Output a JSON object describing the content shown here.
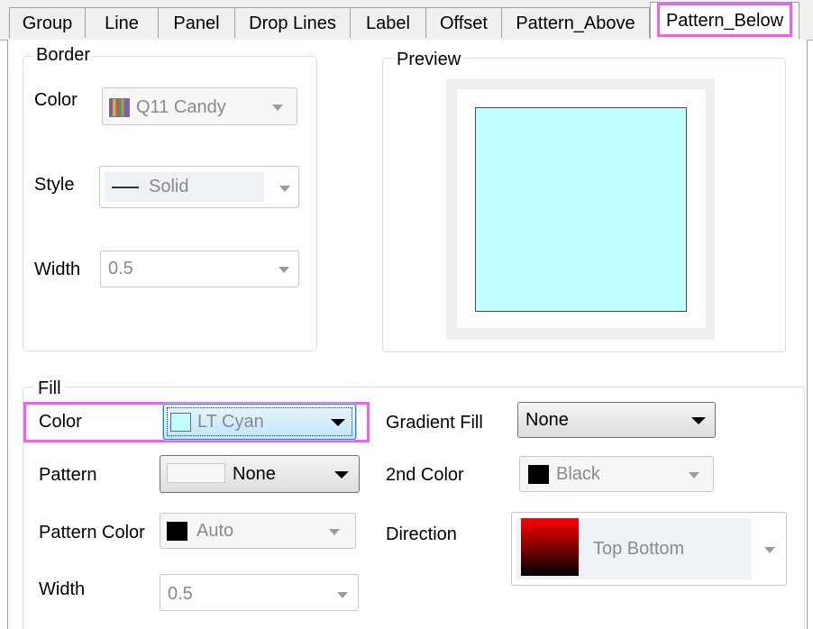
{
  "tabs": [
    {
      "label": "Group"
    },
    {
      "label": "Line"
    },
    {
      "label": "Panel"
    },
    {
      "label": "Drop Lines"
    },
    {
      "label": "Label"
    },
    {
      "label": "Offset"
    },
    {
      "label": "Pattern_Above"
    },
    {
      "label": "Pattern_Below"
    }
  ],
  "active_tab": "Pattern_Below",
  "border": {
    "title": "Border",
    "color_label": "Color",
    "color_value": "Q11 Candy",
    "style_label": "Style",
    "style_value": "Solid",
    "width_label": "Width",
    "width_value": "0.5"
  },
  "preview": {
    "title": "Preview",
    "fill_color": "#bfffff"
  },
  "fill": {
    "title": "Fill",
    "color_label": "Color",
    "color_value": "LT Cyan",
    "color_swatch": "#bfffff",
    "pattern_label": "Pattern",
    "pattern_value": "None",
    "pattern_color_label": "Pattern Color",
    "pattern_color_value": "Auto",
    "width_label": "Width",
    "width_value": "0.5",
    "gradient_fill_label": "Gradient Fill",
    "gradient_fill_value": "None",
    "second_color_label": "2nd Color",
    "second_color_value": "Black",
    "direction_label": "Direction",
    "direction_value": "Top Bottom"
  },
  "highlight_color": "#f25ff2"
}
